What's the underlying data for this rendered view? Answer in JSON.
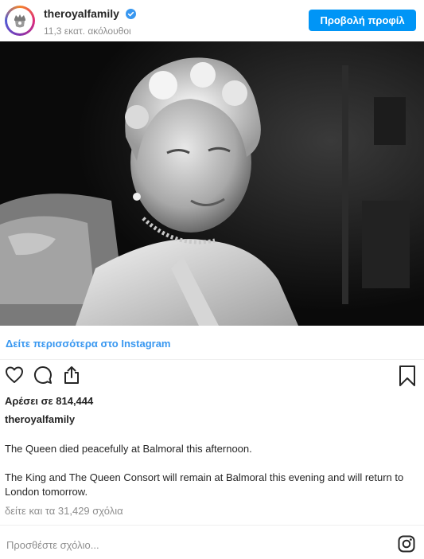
{
  "header": {
    "username": "theroyalfamily",
    "followers": "11,3 εκατ. ακόλουθοι",
    "profile_button": "Προβολή προφίλ"
  },
  "post": {
    "photo_subject": "Queen Elizabeth II black-and-white portrait",
    "view_more": "Δείτε περισσότερα στο Instagram",
    "likes": "Αρέσει σε 814,444",
    "author": "theroyalfamily",
    "caption_line1": "The Queen died peacefully at Balmoral this afternoon.",
    "caption_line2": "The King and The Queen Consort will remain at Balmoral this evening and will return to London tomorrow.",
    "comments_link": "δείτε και τα 31,429 σχόλια"
  },
  "footer": {
    "comment_placeholder": "Προσθέστε σχόλιο..."
  },
  "colors": {
    "accent": "#0095f6",
    "link": "#3897f0",
    "muted": "#8e8e8e",
    "text": "#262626"
  },
  "icons": [
    "verified-badge-icon",
    "heart-icon",
    "comment-icon",
    "share-icon",
    "bookmark-icon",
    "instagram-icon"
  ]
}
